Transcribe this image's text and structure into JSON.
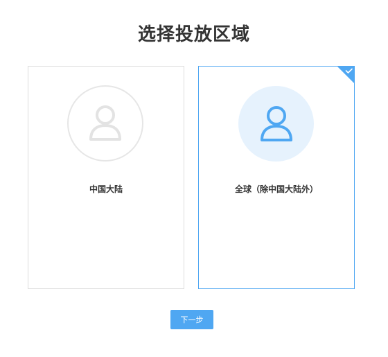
{
  "page": {
    "title": "选择投放区域"
  },
  "cards": [
    {
      "label": "中国大陆",
      "icon": "user-icon",
      "selected": false
    },
    {
      "label": "全球（除中国大陆外）",
      "icon": "user-icon",
      "selected": true
    }
  ],
  "footer": {
    "next_label": "下一步"
  },
  "colors": {
    "accent": "#4fa7f2",
    "selected_avatar_bg": "#e6f2fd",
    "unselected_border": "#dcdcdc",
    "unselected_icon": "#e3e3e3",
    "title_text": "#333333"
  }
}
